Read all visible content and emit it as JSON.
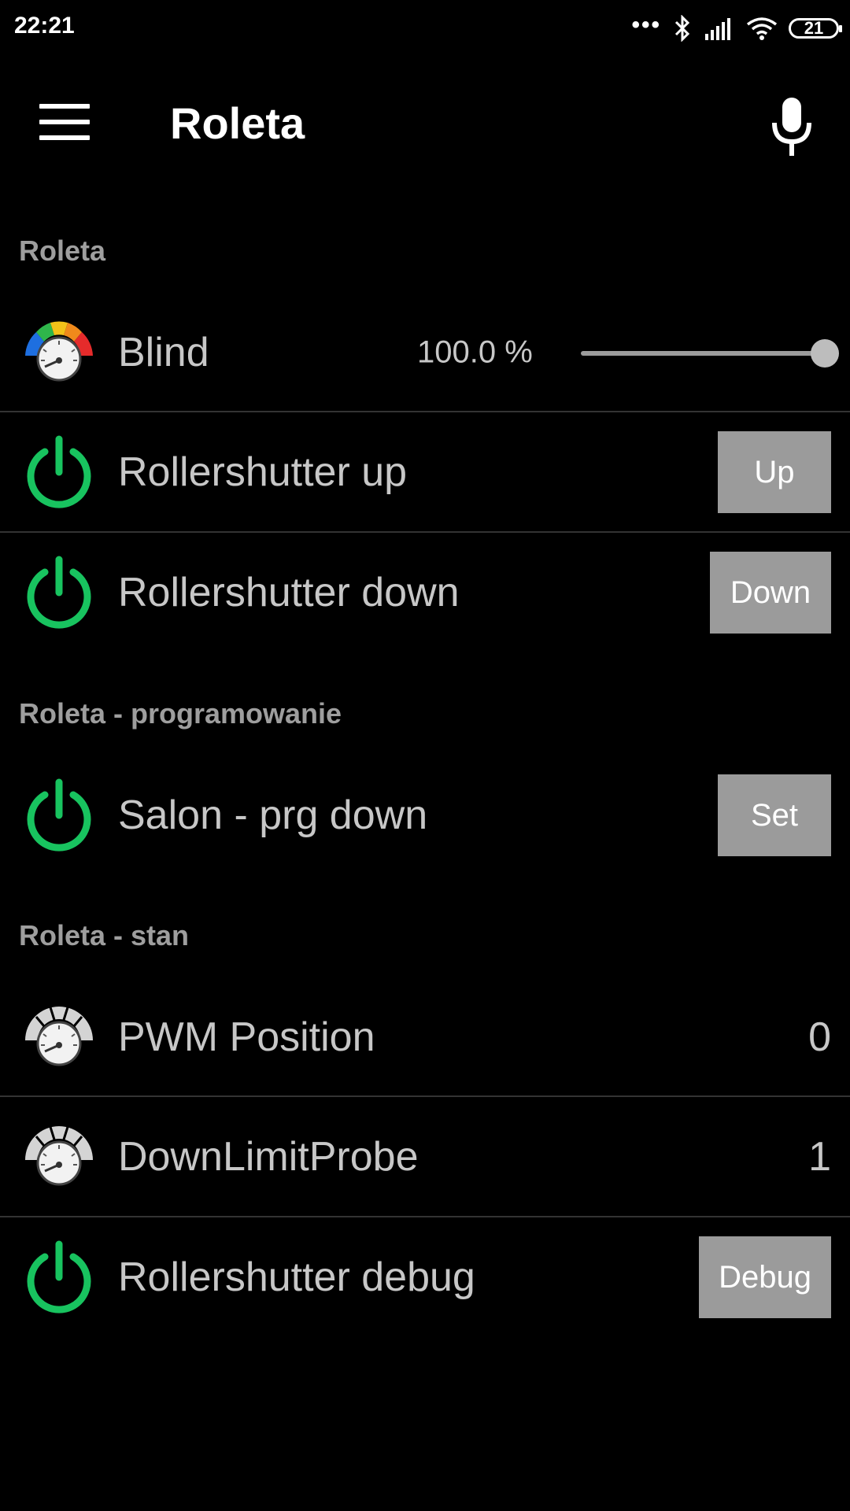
{
  "status_bar": {
    "time": "22:21",
    "battery": "21"
  },
  "app_bar": {
    "title": "Roleta"
  },
  "sections": [
    {
      "header": "Roleta"
    },
    {
      "header": "Roleta - programowanie"
    },
    {
      "header": "Roleta - stan"
    }
  ],
  "blind": {
    "label": "Blind",
    "value_text": "100.0 %",
    "level": 1.0
  },
  "rollershutter_up": {
    "label": "Rollershutter up",
    "button": "Up"
  },
  "rollershutter_down": {
    "label": "Rollershutter down",
    "button": "Down"
  },
  "salon_prg_down": {
    "label": "Salon - prg down",
    "button": "Set"
  },
  "pwm_position": {
    "label": "PWM Position",
    "value": "0"
  },
  "down_limit_probe": {
    "label": "DownLimitProbe",
    "value": "1"
  },
  "rollershutter_debug": {
    "label": "Rollershutter debug",
    "button": "Debug"
  },
  "colors": {
    "power_green": "#18c35f",
    "button_gray": "#9b9b9b",
    "header_gray": "#9e9e9e"
  }
}
